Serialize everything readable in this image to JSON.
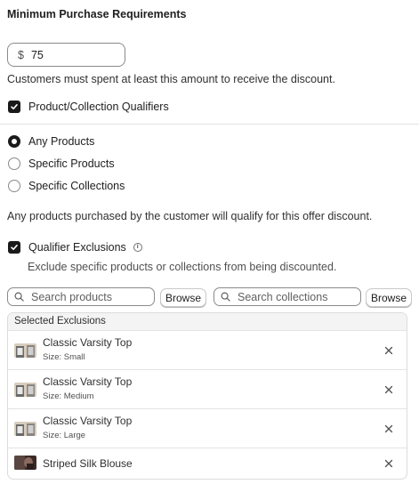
{
  "section": {
    "title": "Minimum Purchase Requirements",
    "currency_symbol": "$",
    "amount_value": "75",
    "help_text": "Customers must spent at least this amount to receive the discount."
  },
  "qualifiers": {
    "checkbox_label": "Product/Collection Qualifiers",
    "checked": true,
    "options": [
      {
        "label": "Any Products",
        "selected": true
      },
      {
        "label": "Specific Products",
        "selected": false
      },
      {
        "label": "Specific Collections",
        "selected": false
      }
    ],
    "note": "Any products purchased by the customer will qualify for this offer discount."
  },
  "exclusions": {
    "checkbox_label": "Qualifier Exclusions",
    "checked": true,
    "info_icon": "info-icon",
    "description": "Exclude specific products or collections from being discounted.",
    "product_search_placeholder": "Search products",
    "collection_search_placeholder": "Search collections",
    "browse_label": "Browse",
    "panel_title": "Selected Exclusions",
    "items": [
      {
        "title": "Classic Varsity Top",
        "subtitle": "Size: Small"
      },
      {
        "title": "Classic Varsity Top",
        "subtitle": "Size: Medium"
      },
      {
        "title": "Classic Varsity Top",
        "subtitle": "Size: Large"
      },
      {
        "title": "Striped Silk Blouse",
        "subtitle": ""
      }
    ]
  },
  "colors": {
    "checkbox_fill": "#1a1a1a",
    "border": "#8a8a8a",
    "divider": "#e3e3e3"
  }
}
